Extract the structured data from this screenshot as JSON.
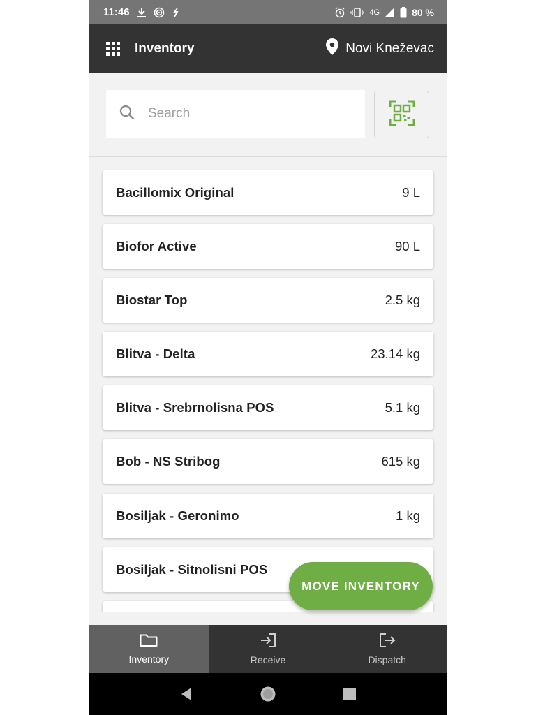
{
  "status_bar": {
    "time": "11:46",
    "network": "4G",
    "battery": "80 %"
  },
  "app_bar": {
    "title": "Inventory",
    "location": "Novi Kneževac"
  },
  "search": {
    "placeholder": "Search",
    "value": ""
  },
  "inventory": [
    {
      "name": "Bacillomix Original",
      "qty": "9 L"
    },
    {
      "name": "Biofor Active",
      "qty": "90 L"
    },
    {
      "name": "Biostar Top",
      "qty": "2.5 kg"
    },
    {
      "name": "Blitva - Delta",
      "qty": "23.14 kg"
    },
    {
      "name": "Blitva - Srebrnolisna POS",
      "qty": "5.1 kg"
    },
    {
      "name": "Bob - NS Stribog",
      "qty": "615 kg"
    },
    {
      "name": "Bosiljak - Geronimo",
      "qty": "1 kg"
    },
    {
      "name": "Bosiljak - Sitnolisni POS",
      "qty": ""
    }
  ],
  "fab": {
    "label": "MOVE INVENTORY"
  },
  "bottom_nav": {
    "tabs": [
      {
        "label": "Inventory",
        "icon": "folder-icon",
        "active": true
      },
      {
        "label": "Receive",
        "icon": "login-icon",
        "active": false
      },
      {
        "label": "Dispatch",
        "icon": "logout-icon",
        "active": false
      }
    ]
  },
  "colors": {
    "accent": "#6fae45",
    "app_bar": "#333333",
    "status_bar": "#757575"
  }
}
